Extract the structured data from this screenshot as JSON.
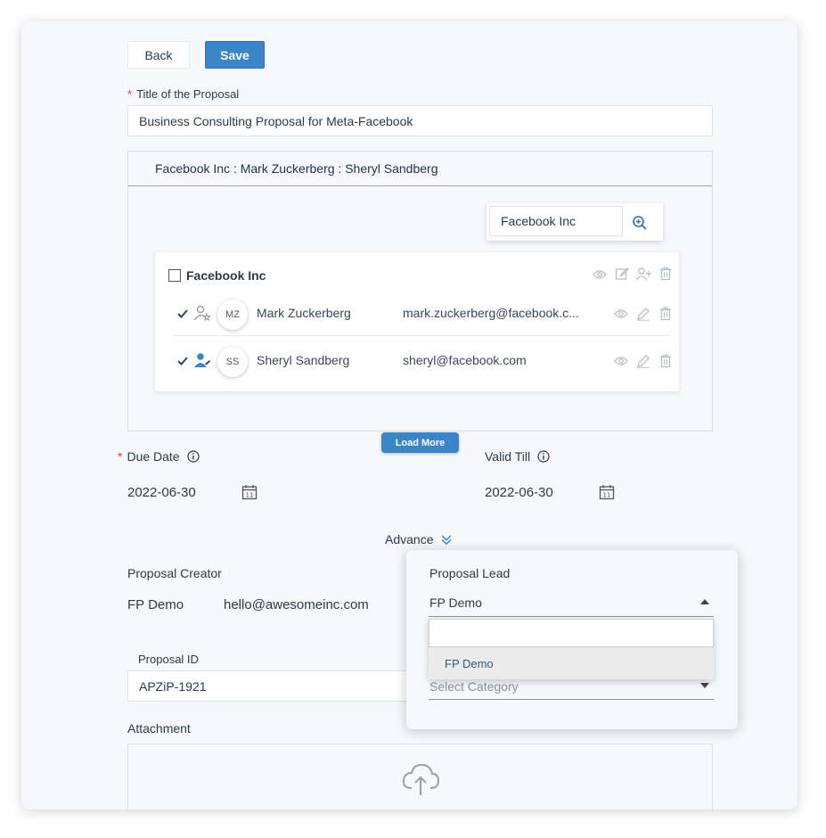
{
  "toolbar": {
    "back_label": "Back",
    "save_label": "Save"
  },
  "title_field": {
    "required_mark": "*",
    "label": "Title of the Proposal",
    "value": "Business Consulting Proposal for Meta-Facebook"
  },
  "contacts_panel": {
    "header": "Facebook Inc : Mark Zuckerberg : Sheryl Sandberg",
    "search_value": "Facebook Inc",
    "company": "Facebook Inc",
    "contacts": [
      {
        "initials": "MZ",
        "name": "Mark Zuckerberg",
        "email": "mark.zuckerberg@facebook.c..."
      },
      {
        "initials": "SS",
        "name": "Sheryl Sandberg",
        "email": "sheryl@facebook.com"
      }
    ],
    "load_more_label": "Load More"
  },
  "due_date": {
    "required_mark": "*",
    "label": "Due Date",
    "value": "2022-06-30"
  },
  "valid_till": {
    "label": "Valid Till",
    "value": "2022-06-30"
  },
  "advance_label": "Advance",
  "proposal_creator": {
    "label": "Proposal Creator",
    "name": "FP Demo",
    "email": "hello@awesomeinc.com"
  },
  "proposal_id": {
    "label": "Proposal ID",
    "value": "APZiP-1921"
  },
  "attachment_label": "Attachment",
  "proposal_lead": {
    "label": "Proposal Lead",
    "selected": "FP Demo",
    "options": [
      "FP Demo"
    ],
    "category_placeholder": "Select Category"
  },
  "colors": {
    "accent": "#3a85c8",
    "required": "#e53935"
  }
}
